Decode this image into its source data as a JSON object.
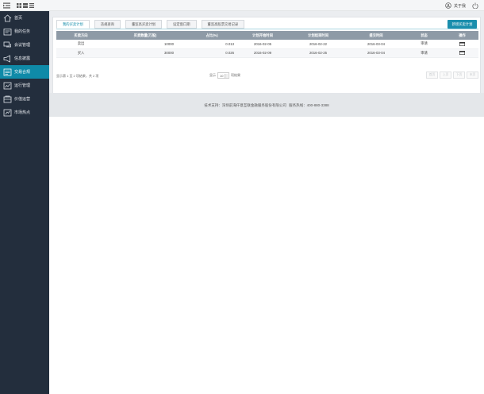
{
  "topbar": {
    "menu_icon": "menu-toggle-icon",
    "view_icons": [
      "grid-view-icon",
      "tile-view-icon",
      "list-view-icon"
    ],
    "about_label": "关于我",
    "about_icon": "user-settings-icon",
    "power_icon": "power-icon"
  },
  "sidebar": {
    "items": [
      {
        "label": "首页",
        "icon": "home-icon"
      },
      {
        "label": "我的任务",
        "icon": "task-icon"
      },
      {
        "label": "会议管理",
        "icon": "chat-icon"
      },
      {
        "label": "信息披露",
        "icon": "megaphone-icon"
      },
      {
        "label": "交易合规",
        "icon": "document-icon",
        "active": true
      },
      {
        "label": "运行管理",
        "icon": "chart-icon"
      },
      {
        "label": "价值运营",
        "icon": "wallet-icon"
      },
      {
        "label": "市场热点",
        "icon": "fire-icon"
      }
    ]
  },
  "tabs": [
    {
      "label": "我的买卖计划",
      "active": true
    },
    {
      "label": "违规查询"
    },
    {
      "label": "董监高买卖计划"
    },
    {
      "label": "设定窗口期"
    },
    {
      "label": "董监高股票交易记录"
    }
  ],
  "actions": {
    "new_plan": "新增买卖计划"
  },
  "table": {
    "headers": [
      "买卖方向",
      "买卖数量(万股)",
      "占比(%)",
      "计划开始时间",
      "计划结束时间",
      "提交时间",
      "状态",
      "操作"
    ],
    "rows": [
      {
        "direction": "卖出",
        "qty": "10000",
        "ratio": "0.013",
        "start": "2016-02-05",
        "end": "2016-02-22",
        "submitted": "2016-03-04",
        "status": "审请"
      },
      {
        "direction": "买入",
        "qty": "30000",
        "ratio": "0.026",
        "start": "2016-02-09",
        "end": "2016-02-25",
        "submitted": "2016-03-04",
        "status": "审请"
      }
    ]
  },
  "pager": {
    "summary": "显示第 1 至 2 项结果，共 2 项",
    "per_page_prefix": "显示",
    "per_page_value": "10",
    "per_page_suffix": "项结果",
    "first": "首页",
    "prev": "上页",
    "next": "下页",
    "last": "末页"
  },
  "footer": {
    "support": "技术支持：深圳前海仟意互联金融服务股份有限公司",
    "hotline": "服务热线：400-880-3388"
  },
  "colors": {
    "sidebar_bg": "#232e3d",
    "accent": "#0f8aa8",
    "table_header": "#8e9aa6"
  }
}
